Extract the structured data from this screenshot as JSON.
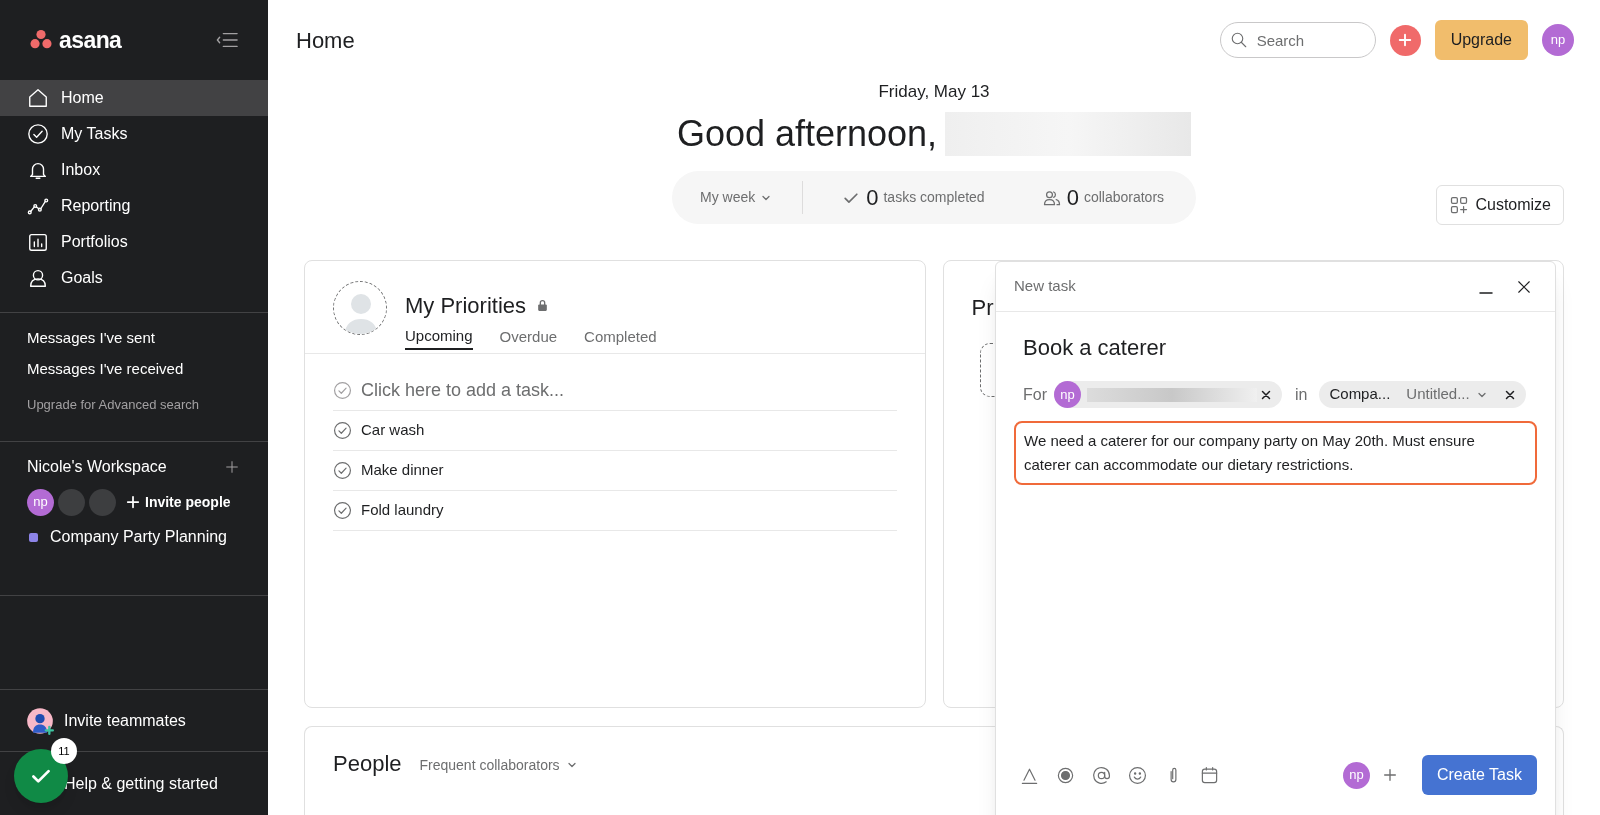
{
  "sidebar": {
    "logo": "asana",
    "nav": [
      {
        "label": "Home",
        "selected": true
      },
      {
        "label": "My Tasks",
        "selected": false
      },
      {
        "label": "Inbox",
        "selected": false
      },
      {
        "label": "Reporting",
        "selected": false
      },
      {
        "label": "Portfolios",
        "selected": false
      },
      {
        "label": "Goals",
        "selected": false
      }
    ],
    "messages": [
      "Messages I've sent",
      "Messages I've received"
    ],
    "upgrade_link": "Upgrade for Advanced search",
    "workspace": {
      "name": "Nicole's Workspace",
      "members": [
        {
          "kind": "avatar",
          "initials": "np"
        },
        {
          "kind": "empty"
        },
        {
          "kind": "empty"
        }
      ],
      "invite": "Invite people",
      "projects": [
        {
          "name": "Company Party Planning",
          "color": "#8d84e8"
        }
      ]
    },
    "invite_teammates": "Invite teammates",
    "help": {
      "label": "Help & getting started",
      "badge": "11"
    }
  },
  "header": {
    "title": "Home",
    "search": {
      "placeholder": "Search"
    },
    "upgrade": "Upgrade",
    "avatar": "np"
  },
  "greeting": {
    "date": "Friday, May 13",
    "text": "Good afternoon,"
  },
  "stats": {
    "period": "My week",
    "tasks_count": "0",
    "tasks_label": "tasks completed",
    "collaborators_count": "0",
    "collaborators_label": "collaborators"
  },
  "customize": "Customize",
  "priorities": {
    "title": "My Priorities",
    "tabs": [
      {
        "label": "Upcoming",
        "selected": true
      },
      {
        "label": "Overdue",
        "selected": false
      },
      {
        "label": "Completed",
        "selected": false
      }
    ],
    "add_task": {
      "placeholder": "Click here to add a task..."
    },
    "tasks": [
      "Car wash",
      "Make dinner",
      "Fold laundry"
    ]
  },
  "projects_card": {
    "title": "Pr"
  },
  "people": {
    "title": "People",
    "filter": "Frequent collaborators"
  },
  "new_task": {
    "header": "New task",
    "title": "Book a caterer",
    "for_label": "For",
    "assignee": "np",
    "in_label": "in",
    "project": "Compa...",
    "section": "Untitled...",
    "description": "We need a caterer for our company party on May 20th. Must ensure caterer can accommodate our dietary restrictions.",
    "follower": "np",
    "create": "Create Task"
  }
}
